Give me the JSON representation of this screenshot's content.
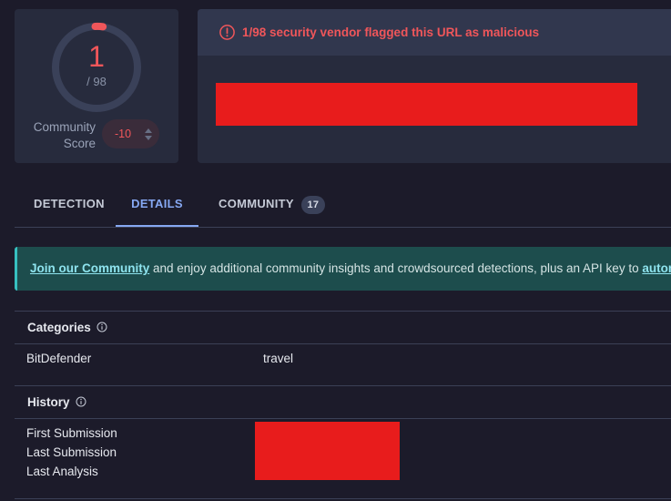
{
  "score": {
    "detections": "1",
    "total": "/ 98",
    "detection_ratio": 0.0102,
    "community_label_line1": "Community",
    "community_label_line2": "Score",
    "community_score": "-10"
  },
  "vendor": {
    "message": "1/98 security vendor flagged this URL as malicious"
  },
  "tabs": [
    {
      "label": "DETECTION"
    },
    {
      "label": "DETAILS"
    },
    {
      "label": "COMMUNITY",
      "badge": "17"
    }
  ],
  "banner": {
    "link_join": "Join our Community",
    "text": "and enjoy additional community insights and crowdsourced detections, plus an API key to",
    "link_automate": "automat"
  },
  "categories": {
    "title": "Categories",
    "rows": [
      {
        "source": "BitDefender",
        "category": "travel"
      }
    ]
  },
  "history": {
    "title": "History",
    "rows": [
      {
        "label": "First Submission"
      },
      {
        "label": "Last Submission"
      },
      {
        "label": "Last Analysis"
      }
    ]
  },
  "colors": {
    "malicious": "#f0565a",
    "accent": "#86a8f2",
    "background": "#1c1b2a",
    "card": "#272b3d",
    "redaction": "#e81c1c"
  }
}
